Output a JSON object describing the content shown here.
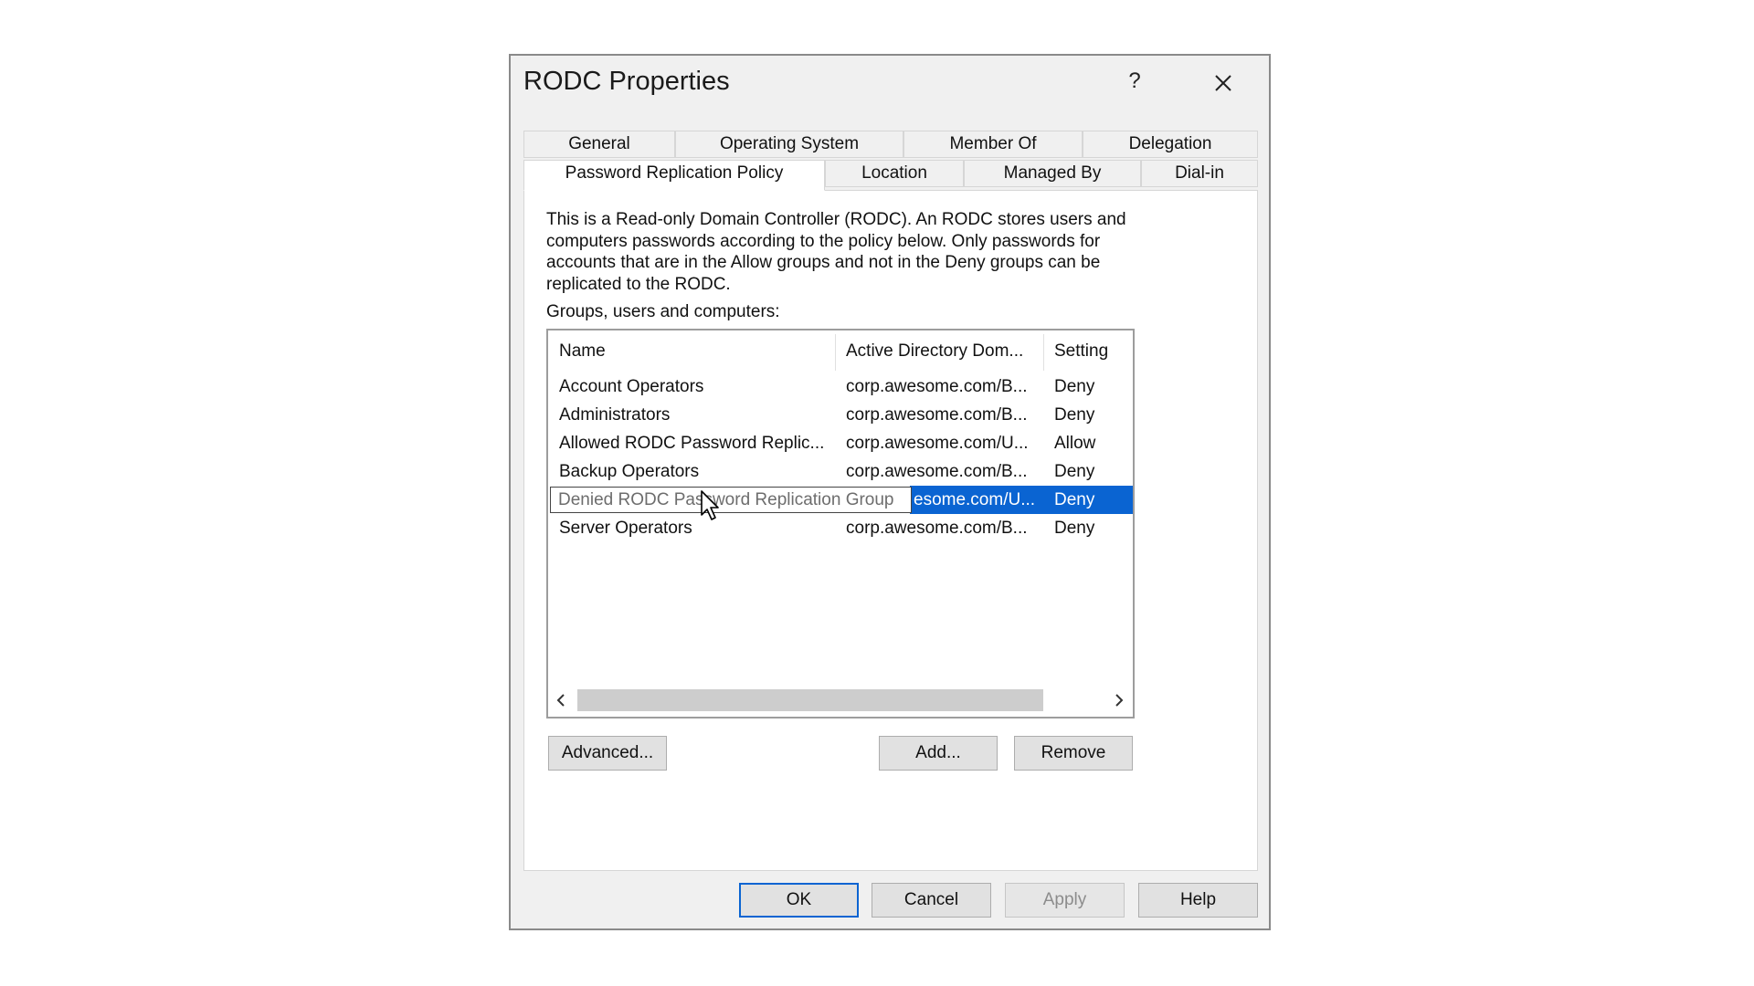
{
  "dialog": {
    "title": "RODC Properties",
    "help_glyph": "?",
    "close_icon": "close-icon"
  },
  "tabs_row1": [
    "General",
    "Operating System",
    "Member Of",
    "Delegation"
  ],
  "tabs_row2": [
    "Password Replication Policy",
    "Location",
    "Managed By",
    "Dial-in"
  ],
  "active_tab": "Password Replication Policy",
  "panel": {
    "description_lines": [
      "This is a Read-only Domain Controller (RODC).  An RODC stores users and",
      "computers passwords according to the policy below.  Only passwords for",
      "accounts that are in the Allow groups and not in the Deny groups can be",
      "replicated to the RODC."
    ],
    "groups_label": "Groups, users and computers:"
  },
  "list": {
    "columns": [
      "Name",
      "Active Directory Dom...",
      "Setting"
    ],
    "rows": [
      {
        "name": "Account Operators",
        "domain": "corp.awesome.com/B...",
        "setting": "Deny"
      },
      {
        "name": "Administrators",
        "domain": "corp.awesome.com/B...",
        "setting": "Deny"
      },
      {
        "name": "Allowed RODC Password Replic...",
        "domain": "corp.awesome.com/U...",
        "setting": "Allow"
      },
      {
        "name": "Backup Operators",
        "domain": "corp.awesome.com/B...",
        "setting": "Deny"
      },
      {
        "name": "Denied RODC Password Replication Group",
        "domain": "esome.com/U...",
        "setting": "Deny"
      },
      {
        "name": "Server Operators",
        "domain": "corp.awesome.com/B...",
        "setting": "Deny"
      }
    ],
    "selected_row": 4
  },
  "buttons": {
    "advanced": "Advanced...",
    "add": "Add...",
    "remove": "Remove",
    "ok": "OK",
    "cancel": "Cancel",
    "apply": "Apply",
    "help": "Help"
  },
  "colors": {
    "selection": "#0a64d2",
    "dialog_bg": "#f0f0f0"
  }
}
